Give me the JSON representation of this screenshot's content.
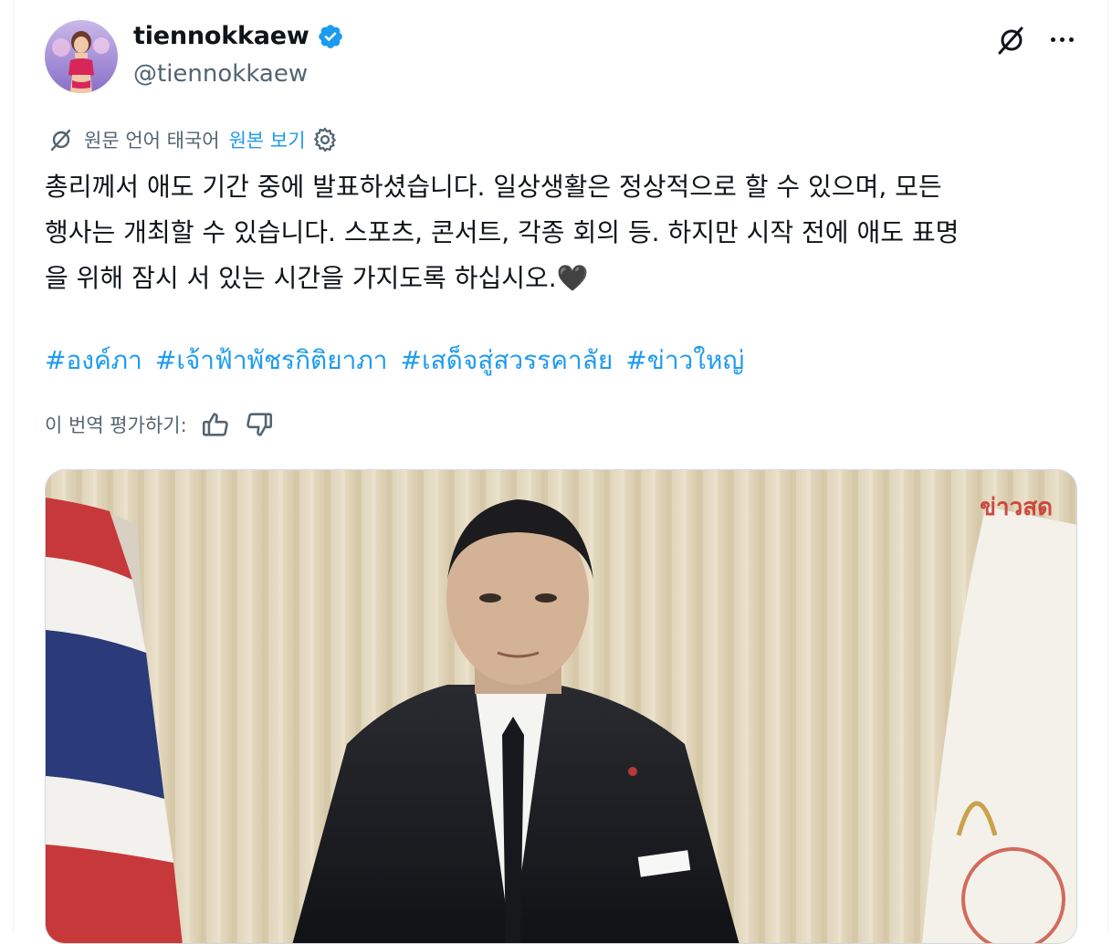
{
  "author": {
    "display_name": "tiennokkaew",
    "handle": "@tiennokkaew",
    "verified": true
  },
  "header_actions": {
    "grok_icon": "grok-icon",
    "more_icon": "more-icon"
  },
  "translation": {
    "source_language_label": "원문 언어 태국어",
    "show_original_link": "원본 보기",
    "settings_icon": "gear-icon"
  },
  "post": {
    "body_lines": [
      "총리께서 애도 기간 중에 발표하셨습니다. 일상생활은 정상적으로 할 수 있으며, 모든",
      "행사는 개최할 수 있습니다. 스포츠, 콘서트, 각종 회의 등. 하지만 시작 전에 애도 표명",
      "을 위해 잠시 서 있는 시간을 가지도록 하십시오.🖤"
    ],
    "hashtags": [
      "#องค์ภา",
      "#เจ้าฟ้าพัชรกิติยาภา",
      "#เสด็จสู่สวรรคาลัย",
      "#ข่าวใหญ่"
    ]
  },
  "rating": {
    "label": "이 번역 평가하기:",
    "thumbs_up_icon": "thumbs-up-icon",
    "thumbs_down_icon": "thumbs-down-icon"
  },
  "media": {
    "watermark": "ข่าวสด"
  },
  "colors": {
    "accent": "#1d9bf0",
    "text_primary": "#0f1419",
    "text_secondary": "#536471",
    "border": "#cfd9de"
  }
}
